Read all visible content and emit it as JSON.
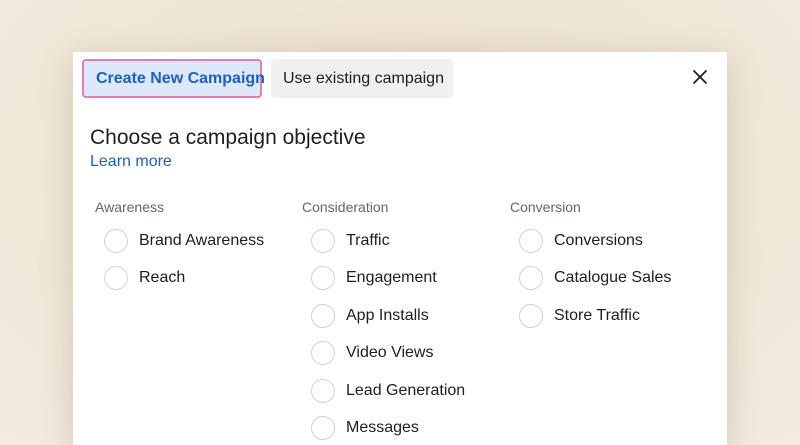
{
  "tabs": [
    {
      "label": "Create New Campaign",
      "active": true
    },
    {
      "label": "Use existing campaign",
      "active": false
    }
  ],
  "close_icon": "close-icon",
  "title": "Choose a campaign objective",
  "learn_more": "Learn more",
  "columns": [
    {
      "title": "Awareness",
      "options": [
        "Brand Awareness",
        "Reach"
      ]
    },
    {
      "title": "Consideration",
      "options": [
        "Traffic",
        "Engagement",
        "App Installs",
        "Video Views",
        "Lead Generation",
        "Messages"
      ]
    },
    {
      "title": "Conversion",
      "options": [
        "Conversions",
        "Catalogue Sales",
        "Store Traffic"
      ]
    }
  ],
  "colors": {
    "accent": "#1f5fbf",
    "active_tab_bg": "#dde8fb",
    "active_tab_border": "#e07fb7",
    "link": "#1c62b9"
  }
}
